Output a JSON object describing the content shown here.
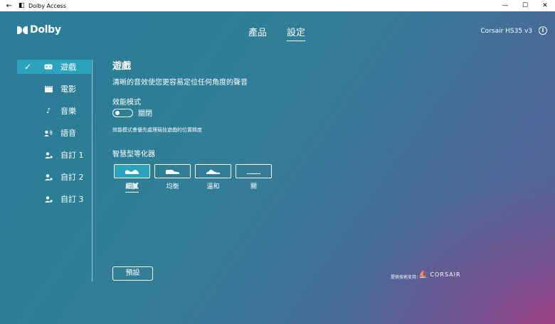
{
  "window": {
    "back_glyph": "←",
    "app_icon_glyph": "◧",
    "title": "Dolby Access",
    "controls": {
      "minimize": "—",
      "maximize": "☐",
      "close": "✕"
    }
  },
  "header": {
    "brand": "Dolby",
    "tabs": [
      {
        "label": "產品",
        "active": false
      },
      {
        "label": "設定",
        "active": true
      }
    ],
    "device": "Corsair HS35 v3",
    "info_glyph": "i"
  },
  "sidebar": {
    "check_glyph": "✓",
    "items": [
      {
        "label": "遊戲",
        "icon": "game-controller-icon",
        "glyph": "▭",
        "active": true
      },
      {
        "label": "電影",
        "icon": "movie-clapper-icon",
        "glyph": "▬",
        "active": false
      },
      {
        "label": "音樂",
        "icon": "music-note-icon",
        "glyph": "♪",
        "active": false
      },
      {
        "label": "語音",
        "icon": "voice-icon",
        "glyph": "◗",
        "active": false
      },
      {
        "label": "自訂 1",
        "icon": "custom-profile-icon",
        "glyph": "☻",
        "active": false
      },
      {
        "label": "自訂 2",
        "icon": "custom-profile-icon",
        "glyph": "☻",
        "active": false
      },
      {
        "label": "自訂 3",
        "icon": "custom-profile-icon",
        "glyph": "☻",
        "active": false
      }
    ]
  },
  "content": {
    "title": "遊戲",
    "description": "清晰的音效使您更容易定位任何角度的聲音",
    "performance_mode_label": "效能模式",
    "performance_toggle_state": "關閉",
    "performance_note": "效能模式會優先處理競技遊戲的位置精度",
    "equalizer_label": "智慧型等化器",
    "equalizer_options": [
      {
        "label": "細膩",
        "icon": "eq-detailed-icon",
        "selected": true
      },
      {
        "label": "均衡",
        "icon": "eq-balanced-icon",
        "selected": false
      },
      {
        "label": "溫和",
        "icon": "eq-warm-icon",
        "selected": false
      },
      {
        "label": "關",
        "icon": "eq-off-icon",
        "selected": false
      }
    ],
    "preset_button": "預設"
  },
  "footer": {
    "powered_by": "提供技術支持：",
    "partner_brand": "CORSAIR",
    "partner_glyph": "⛵"
  },
  "colors": {
    "accent": "#2aa4bd",
    "background_start": "#2b7d98",
    "background_end": "#a83c84"
  }
}
